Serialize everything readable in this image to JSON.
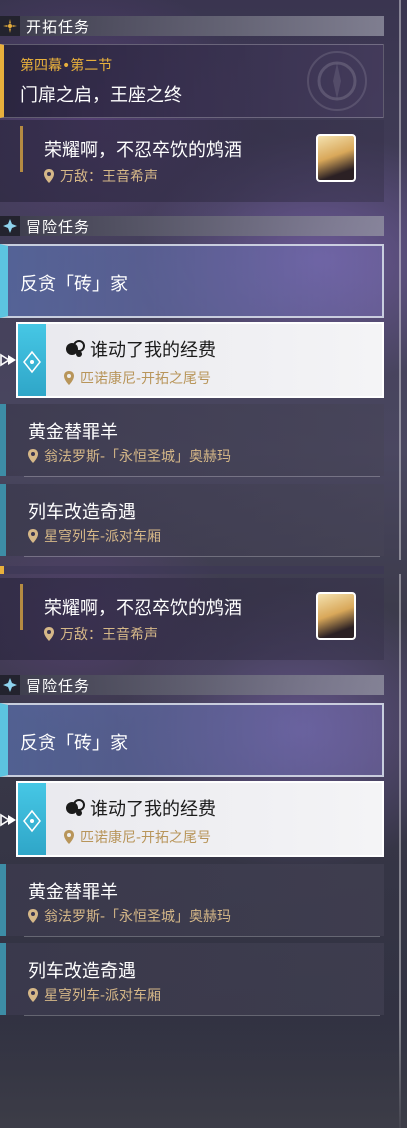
{
  "sections": {
    "trailblaze_title": "开拓任务",
    "adventure_title": "冒险任务"
  },
  "trailblaze": {
    "chapter": "第四幕•第二节",
    "title": "门扉之启，王座之终"
  },
  "npc_quest": {
    "title": "荣耀啊，不忍卒饮的鸩酒",
    "location": "万敌：王音希声"
  },
  "adventure": {
    "item1": {
      "title": "反贪「砖」家"
    },
    "item2": {
      "title": "谁动了我的经费",
      "location": "匹诺康尼-开拓之尾号"
    },
    "item3": {
      "title": "黄金替罪羊",
      "location": "翁法罗斯-「永恒圣城」奥赫玛"
    },
    "item4": {
      "title": "列车改造奇遇",
      "location": "星穹列车-派对车厢"
    }
  },
  "icons": {
    "trailblaze": "trailblaze-quest-icon",
    "adventure": "adventure-quest-icon",
    "location": "map-pin-icon",
    "tracking": "tracking-pointer-icon",
    "active_mission": "mission-type-icon"
  },
  "colors": {
    "accent_gold": "#e8b03c",
    "accent_cyan": "#46c7e5",
    "location_text": "#d6b888"
  }
}
